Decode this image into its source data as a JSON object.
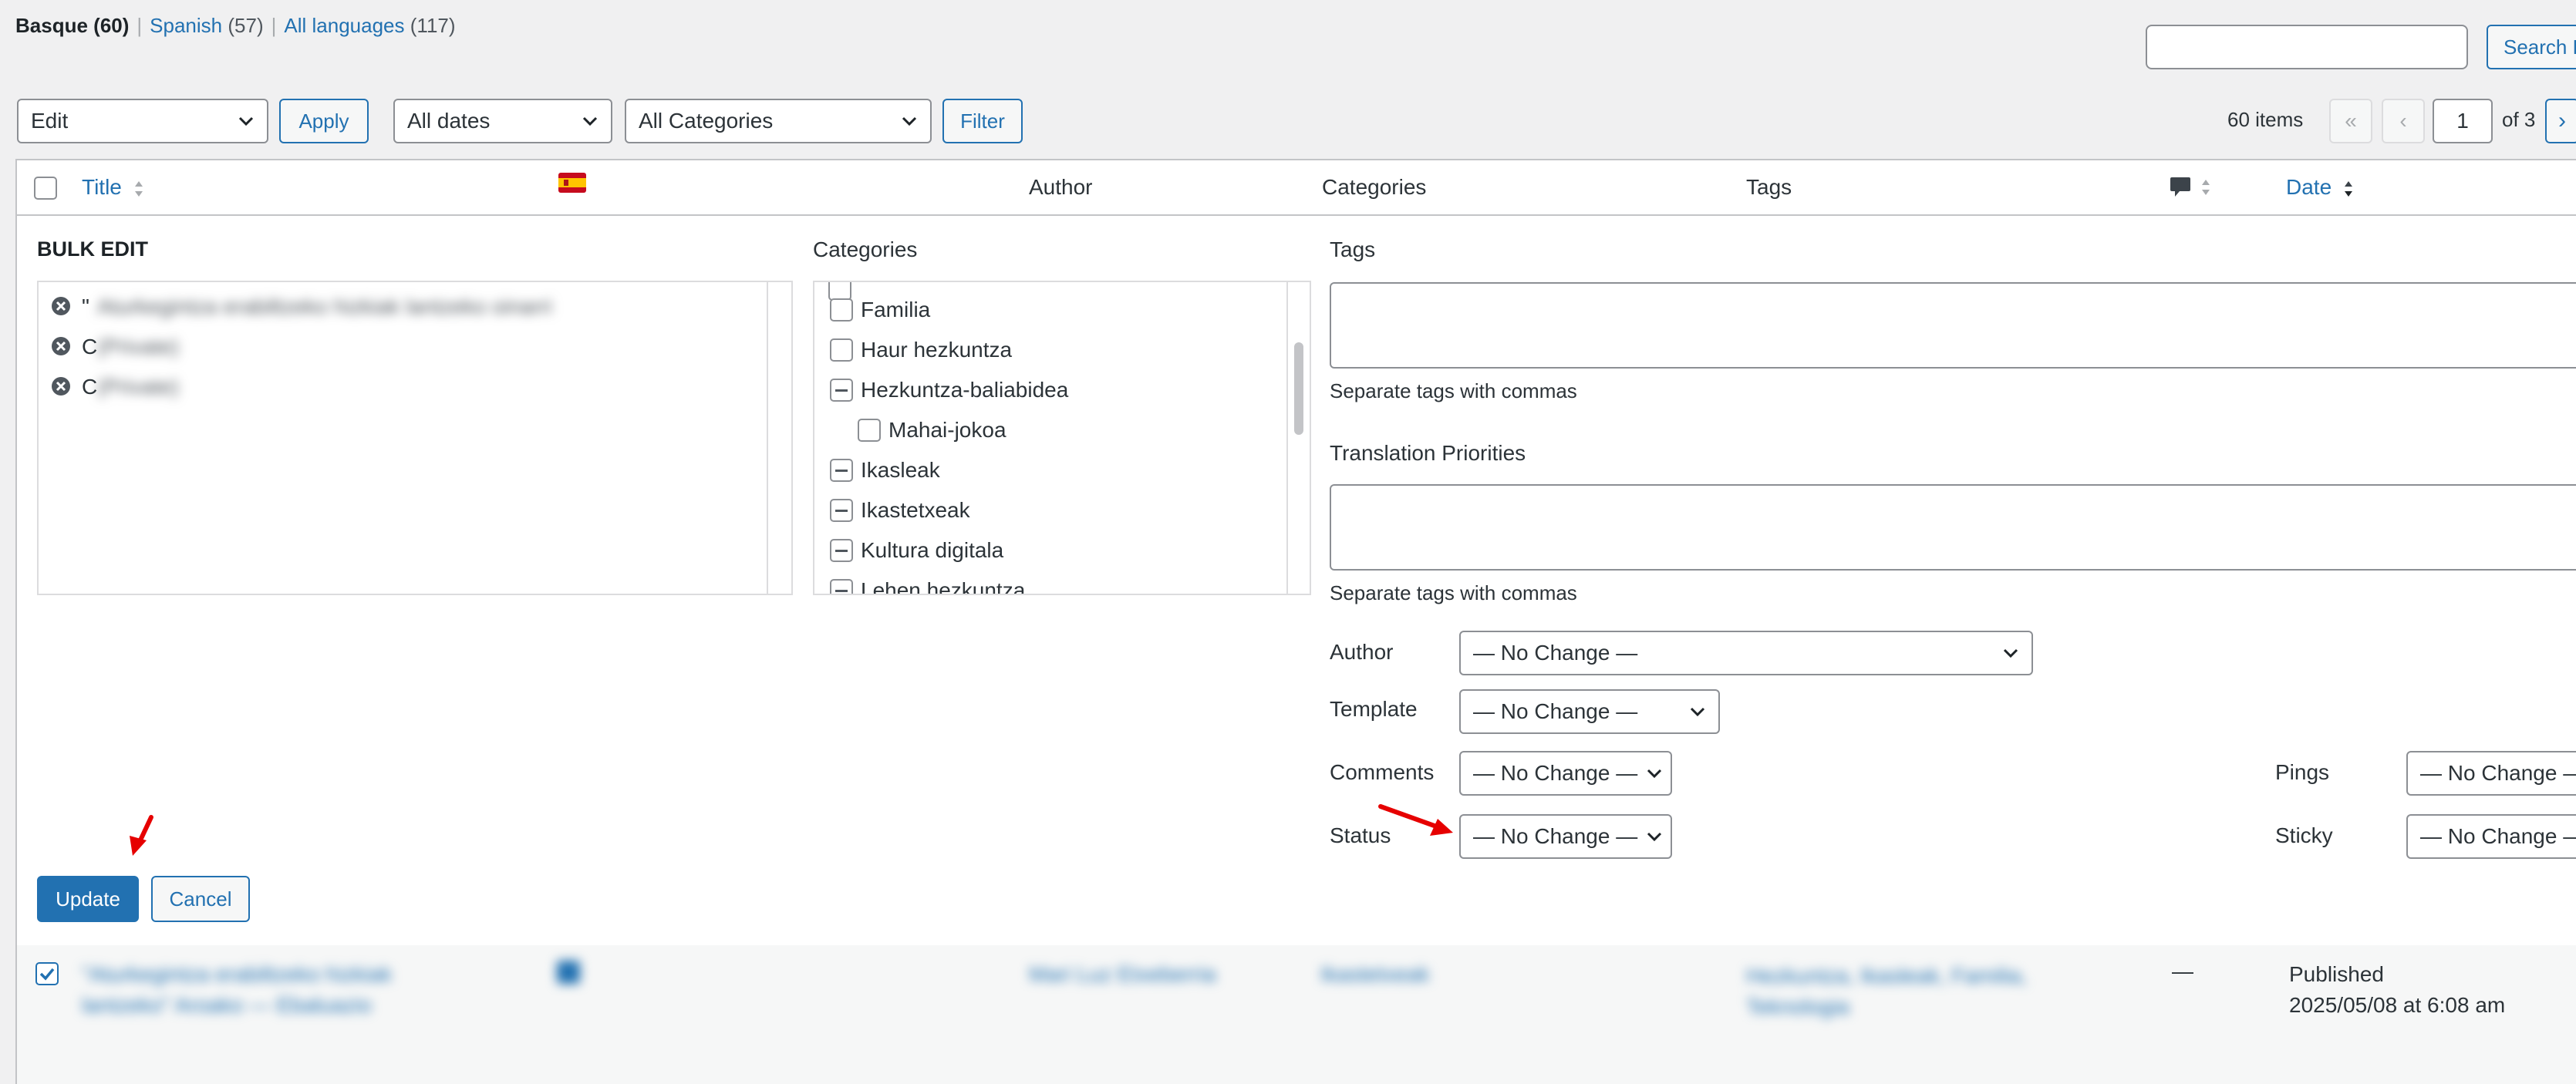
{
  "subsubsub": {
    "items": [
      {
        "label": "Basque",
        "count": "(60)"
      },
      {
        "label": "Spanish",
        "count": "(57)"
      },
      {
        "label": "All languages",
        "count": "(117)"
      }
    ],
    "sep": "|"
  },
  "search": {
    "button_label": "Search P",
    "value": ""
  },
  "filters": {
    "bulk_action": "Edit",
    "apply_label": "Apply",
    "dates": "All dates",
    "categories": "All Categories",
    "filter_label": "Filter"
  },
  "pagination": {
    "items_count": "60 items",
    "first": "«",
    "prev": "‹",
    "current_page": "1",
    "of_total": "of 3",
    "next": "›"
  },
  "table_header": {
    "title": "Title",
    "author": "Author",
    "categories": "Categories",
    "tags": "Tags",
    "date": "Date"
  },
  "bulk_edit": {
    "heading": "BULK EDIT",
    "items": [
      {
        "prefix": "\"",
        "blurred": "Aturkegintza erabiltzeko hizkiak lantzeko oinarri"
      },
      {
        "prefix": "C",
        "blurred": "(Private)"
      },
      {
        "prefix": "C",
        "blurred": "(Private)"
      }
    ],
    "categories_label": "Categories",
    "category_items": [
      {
        "label": "Familia",
        "state": "unchecked",
        "indent": 0
      },
      {
        "label": "Haur hezkuntza",
        "state": "unchecked",
        "indent": 0
      },
      {
        "label": "Hezkuntza-baliabidea",
        "state": "partial",
        "indent": 0
      },
      {
        "label": "Mahai-jokoa",
        "state": "unchecked",
        "indent": 1
      },
      {
        "label": "Ikasleak",
        "state": "partial",
        "indent": 0
      },
      {
        "label": "Ikastetxeak",
        "state": "partial",
        "indent": 0
      },
      {
        "label": "Kultura digitala",
        "state": "partial",
        "indent": 0
      },
      {
        "label": "Lehen hezkuntza",
        "state": "partial",
        "indent": 0
      }
    ],
    "tags_label": "Tags",
    "tags_hint": "Separate tags with commas",
    "priorities_label": "Translation Priorities",
    "priorities_hint": "Separate tags with commas",
    "author_label": "Author",
    "author_value": "— No Change —",
    "template_label": "Template",
    "template_value": "— No Change —",
    "comments_label": "Comments",
    "comments_value": "— No Change —",
    "pings_label": "Pings",
    "pings_value": "— No Change —",
    "status_label": "Status",
    "status_value": "— No Change —",
    "sticky_label": "Sticky",
    "sticky_value": "— No Change —",
    "update_label": "Update",
    "cancel_label": "Cancel"
  },
  "row": {
    "title_blurred": "\"Aturkegintza erabiltzeko hizkiak lantzeko\" Aroako — Ebaluazio",
    "author_blurred": "Mari Luz Etxeberria",
    "categories_blurred": "Ikastetxeak",
    "tags_blurred": "Hezkuntza, Ikasleak, Familia, Teknologia",
    "comments": "—",
    "status": "Published",
    "date": "2025/05/08 at 6:08 am"
  },
  "colors": {
    "accent": "#2271b1",
    "annotation_arrow": "#e60000"
  }
}
